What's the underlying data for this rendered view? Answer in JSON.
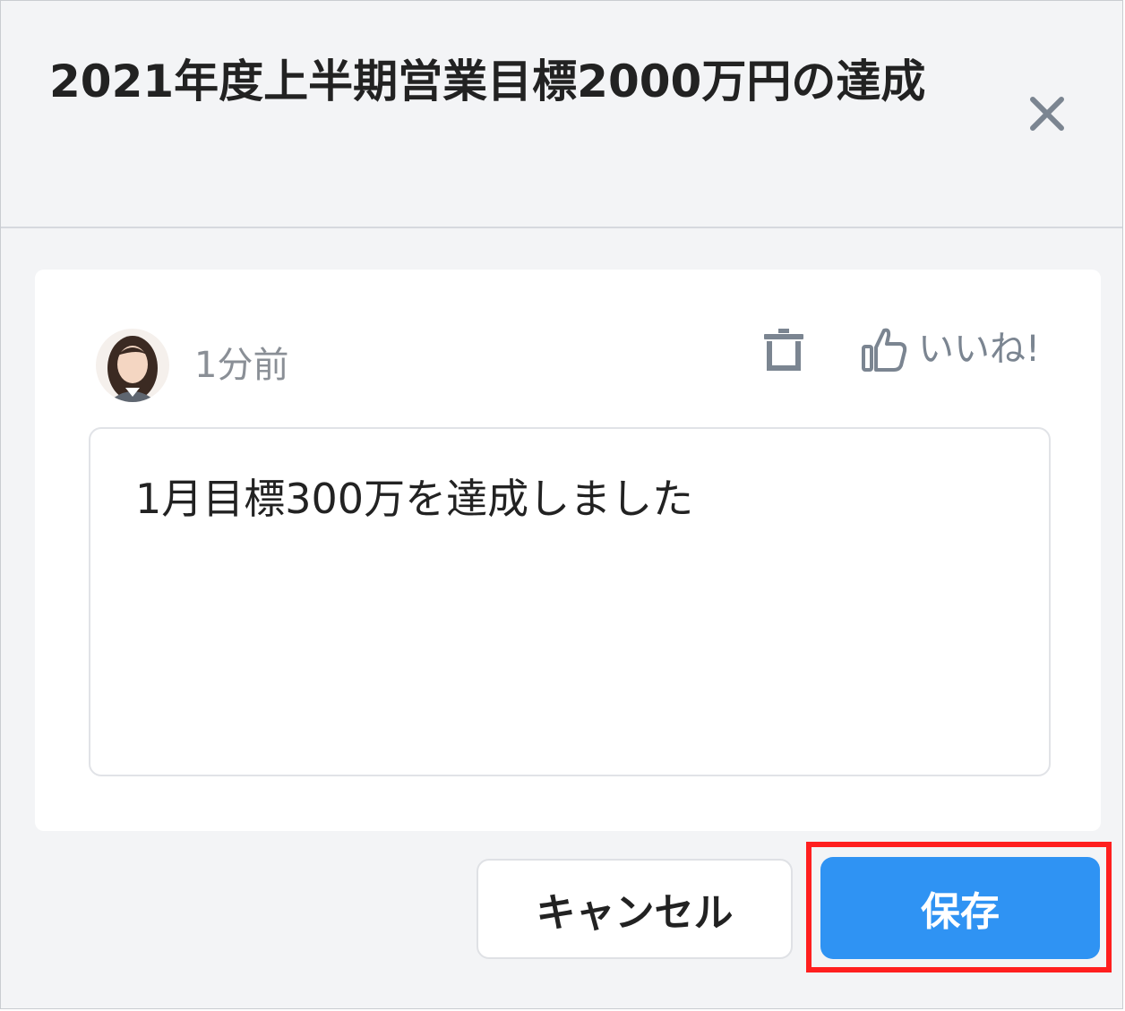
{
  "dialog": {
    "title": "2021年度上半期営業目標2000万円の達成",
    "close_icon": "close-icon"
  },
  "comment": {
    "avatar_icon": "user-avatar",
    "timestamp": "1分前",
    "delete_icon": "trash-icon",
    "like_icon": "thumbs-up-icon",
    "like_label": "いいね!",
    "text": "1月目標300万を達成しました"
  },
  "actions": {
    "cancel_label": "キャンセル",
    "save_label": "保存"
  },
  "colors": {
    "primary": "#2f93f3",
    "highlight": "#ff1f1f",
    "icon_gray": "#7b8591"
  }
}
